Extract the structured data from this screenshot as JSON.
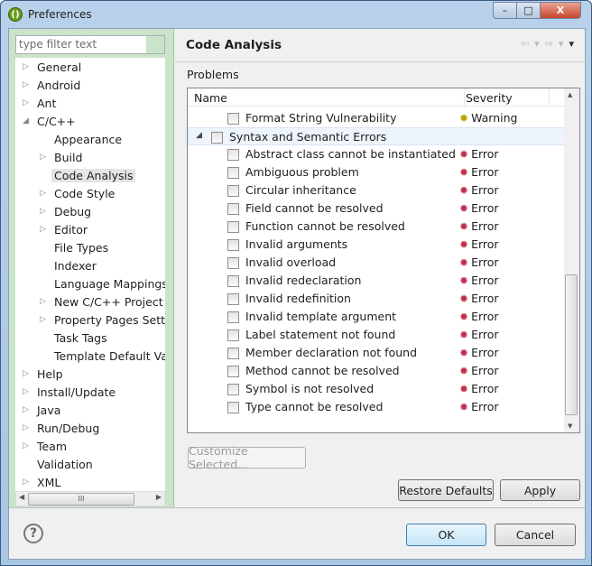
{
  "window": {
    "title": "Preferences",
    "min": "–",
    "max": "□",
    "close": "X"
  },
  "filter": {
    "placeholder": "type filter text"
  },
  "tree": [
    {
      "label": "General",
      "level": 0,
      "arrow": "▷"
    },
    {
      "label": "Android",
      "level": 0,
      "arrow": "▷"
    },
    {
      "label": "Ant",
      "level": 0,
      "arrow": "▷"
    },
    {
      "label": "C/C++",
      "level": 0,
      "arrow": "◢"
    },
    {
      "label": "Appearance",
      "level": 1,
      "arrow": ""
    },
    {
      "label": "Build",
      "level": 1,
      "arrow": "▷"
    },
    {
      "label": "Code Analysis",
      "level": 1,
      "arrow": "",
      "selected": true
    },
    {
      "label": "Code Style",
      "level": 1,
      "arrow": "▷"
    },
    {
      "label": "Debug",
      "level": 1,
      "arrow": "▷"
    },
    {
      "label": "Editor",
      "level": 1,
      "arrow": "▷"
    },
    {
      "label": "File Types",
      "level": 1,
      "arrow": ""
    },
    {
      "label": "Indexer",
      "level": 1,
      "arrow": ""
    },
    {
      "label": "Language Mappings",
      "level": 1,
      "arrow": ""
    },
    {
      "label": "New C/C++ Project W",
      "level": 1,
      "arrow": "▷"
    },
    {
      "label": "Property Pages Settin",
      "level": 1,
      "arrow": "▷"
    },
    {
      "label": "Task Tags",
      "level": 1,
      "arrow": ""
    },
    {
      "label": "Template Default Valu",
      "level": 1,
      "arrow": ""
    },
    {
      "label": "Help",
      "level": 0,
      "arrow": "▷"
    },
    {
      "label": "Install/Update",
      "level": 0,
      "arrow": "▷"
    },
    {
      "label": "Java",
      "level": 0,
      "arrow": "▷"
    },
    {
      "label": "Run/Debug",
      "level": 0,
      "arrow": "▷"
    },
    {
      "label": "Team",
      "level": 0,
      "arrow": "▷"
    },
    {
      "label": "Validation",
      "level": 0,
      "arrow": ""
    },
    {
      "label": "XML",
      "level": 0,
      "arrow": "▷"
    }
  ],
  "tree_scroll_thumb": "III",
  "page": {
    "title": "Code Analysis",
    "problems_label": "Problems"
  },
  "table": {
    "columns": [
      "Name",
      "Severity"
    ],
    "rows": [
      {
        "name": "Format String Vulnerability",
        "severity": "Warning",
        "type": "item"
      },
      {
        "name": "Syntax and Semantic Errors",
        "severity": "",
        "type": "group"
      },
      {
        "name": "Abstract class cannot be instantiated",
        "severity": "Error",
        "type": "item"
      },
      {
        "name": "Ambiguous problem",
        "severity": "Error",
        "type": "item"
      },
      {
        "name": "Circular inheritance",
        "severity": "Error",
        "type": "item"
      },
      {
        "name": "Field cannot be resolved",
        "severity": "Error",
        "type": "item"
      },
      {
        "name": "Function cannot be resolved",
        "severity": "Error",
        "type": "item"
      },
      {
        "name": "Invalid arguments",
        "severity": "Error",
        "type": "item"
      },
      {
        "name": "Invalid overload",
        "severity": "Error",
        "type": "item"
      },
      {
        "name": "Invalid redeclaration",
        "severity": "Error",
        "type": "item"
      },
      {
        "name": "Invalid redefinition",
        "severity": "Error",
        "type": "item"
      },
      {
        "name": "Invalid template argument",
        "severity": "Error",
        "type": "item"
      },
      {
        "name": "Label statement not found",
        "severity": "Error",
        "type": "item"
      },
      {
        "name": "Member declaration not found",
        "severity": "Error",
        "type": "item"
      },
      {
        "name": "Method cannot be resolved",
        "severity": "Error",
        "type": "item"
      },
      {
        "name": "Symbol is not resolved",
        "severity": "Error",
        "type": "item"
      },
      {
        "name": "Type cannot be resolved",
        "severity": "Error",
        "type": "item"
      }
    ]
  },
  "colors": {
    "warning": "#b8a000",
    "error": "#c0304a",
    "tree_bg": "#c9e4c9"
  },
  "buttons": {
    "customize": "Customize Selected...",
    "restore": "Restore Defaults",
    "apply": "Apply",
    "ok": "OK",
    "cancel": "Cancel",
    "help": "?"
  }
}
